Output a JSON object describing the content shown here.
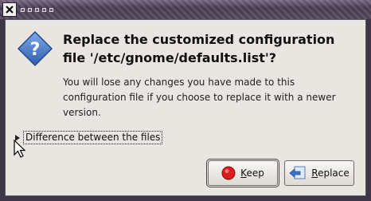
{
  "window": {
    "close_icon": "close-icon"
  },
  "dialog": {
    "icon": "question-icon",
    "title": "Replace the customized configuration file '/etc/gnome/defaults.list'?",
    "message": "You will lose any changes you have made to this configuration file if you choose to replace it with a newer version.",
    "expander": {
      "label": "Difference between the files",
      "icon": "expander-arrow-icon",
      "expanded": false
    },
    "buttons": {
      "keep": {
        "label_mnemonic": "K",
        "label_rest": "eep",
        "icon": "stop-icon"
      },
      "replace": {
        "label_mnemonic": "R",
        "label_rest": "eplace",
        "icon": "replace-icon"
      }
    }
  },
  "colors": {
    "dialog_bg": "#e9e6e1",
    "titlebar": "#4a3e55",
    "question_icon": "#3d6fbf",
    "stop_icon": "#d81e1e"
  }
}
